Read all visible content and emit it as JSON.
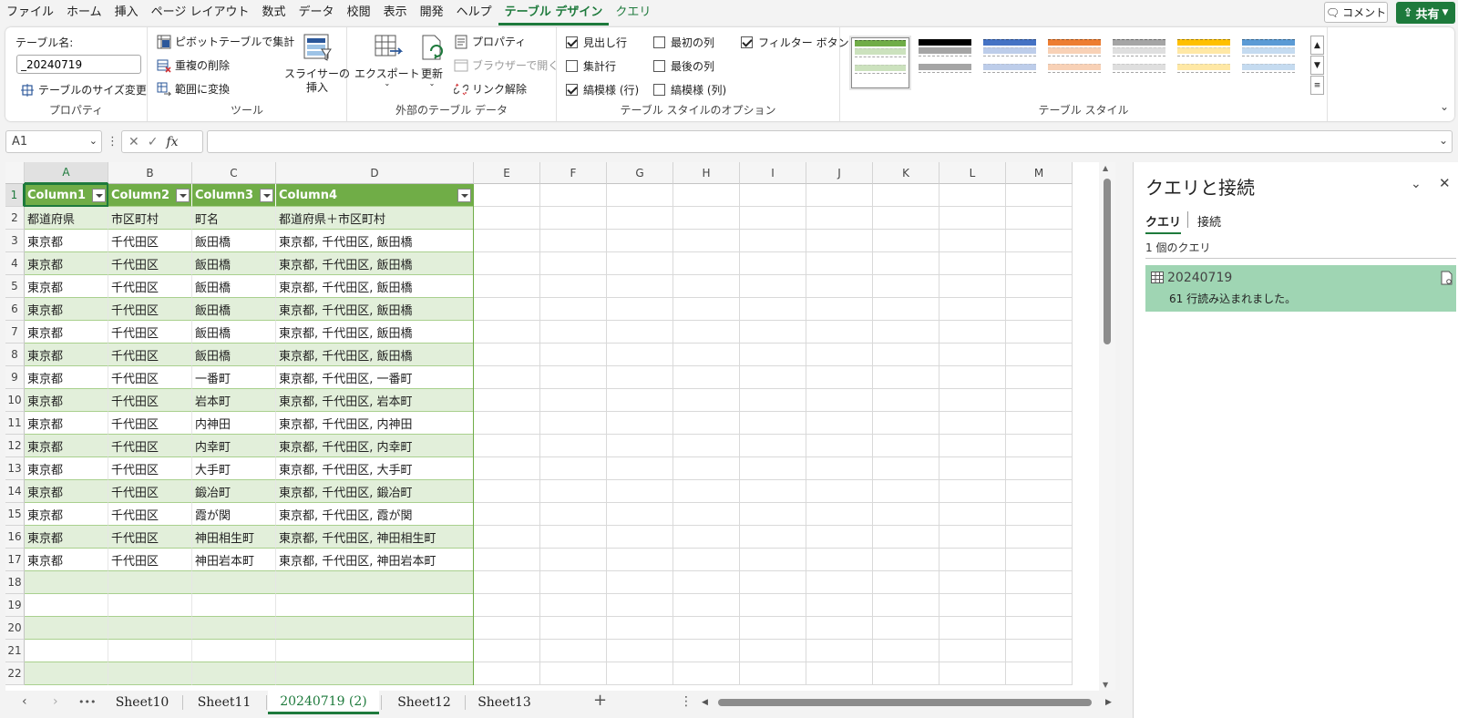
{
  "menu": {
    "tabs": [
      "ファイル",
      "ホーム",
      "挿入",
      "ページ レイアウト",
      "数式",
      "データ",
      "校閲",
      "表示",
      "開発",
      "ヘルプ",
      "テーブル デザイン",
      "クエリ"
    ],
    "active_index": 10,
    "comment_label": "コメント",
    "share_label": "共有"
  },
  "ribbon": {
    "properties": {
      "table_name_label": "テーブル名:",
      "table_name_value": "_20240719",
      "resize_label": "テーブルのサイズ変更",
      "group_label": "プロパティ"
    },
    "tools": {
      "pivot_label": "ピボットテーブルで集計",
      "remove_dup_label": "重複の削除",
      "convert_label": "範囲に変換",
      "slicer_label_1": "スライサーの",
      "slicer_label_2": "挿入",
      "group_label": "ツール"
    },
    "external": {
      "export_label": "エクスポート",
      "refresh_label": "更新",
      "properties_label": "プロパティ",
      "browser_label": "ブラウザーで開く",
      "unlink_label": "リンク解除",
      "group_label": "外部のテーブル データ"
    },
    "style_options": {
      "header_row": "見出し行",
      "total_row": "集計行",
      "banded_rows": "縞模様 (行)",
      "first_col": "最初の列",
      "last_col": "最後の列",
      "banded_cols": "縞模様 (列)",
      "filter_btn": "フィルター ボタン",
      "group_label": "テーブル スタイルのオプション",
      "header_row_checked": true,
      "total_row_checked": false,
      "banded_rows_checked": true,
      "first_col_checked": false,
      "last_col_checked": false,
      "banded_cols_checked": false,
      "filter_btn_checked": true
    },
    "styles": {
      "group_label": "テーブル スタイル",
      "swatch_colors": [
        "#70ad47",
        "#000000",
        "#4472c4",
        "#ed7d31",
        "#a5a5a5",
        "#ffc000",
        "#5b9bd5"
      ]
    }
  },
  "formula_bar": {
    "cell_ref": "A1",
    "fx_label": "fx",
    "formula": ""
  },
  "grid": {
    "columns": [
      "A",
      "B",
      "C",
      "D",
      "E",
      "F",
      "G",
      "H",
      "I",
      "J",
      "K",
      "L",
      "M"
    ],
    "rows": [
      "1",
      "2",
      "3",
      "4",
      "5",
      "6",
      "7",
      "8",
      "9",
      "10",
      "11",
      "12",
      "13",
      "14",
      "15",
      "16",
      "17",
      "18",
      "19",
      "20",
      "21",
      "22"
    ],
    "table_headers": [
      "Column1",
      "Column2",
      "Column3",
      "Column4"
    ],
    "table_rows": [
      [
        "都道府県",
        "市区町村",
        "町名",
        "都道府県＋市区町村"
      ],
      [
        "東京都",
        "千代田区",
        "飯田橋",
        "東京都, 千代田区, 飯田橋"
      ],
      [
        "東京都",
        "千代田区",
        "飯田橋",
        "東京都, 千代田区, 飯田橋"
      ],
      [
        "東京都",
        "千代田区",
        "飯田橋",
        "東京都, 千代田区, 飯田橋"
      ],
      [
        "東京都",
        "千代田区",
        "飯田橋",
        "東京都, 千代田区, 飯田橋"
      ],
      [
        "東京都",
        "千代田区",
        "飯田橋",
        "東京都, 千代田区, 飯田橋"
      ],
      [
        "東京都",
        "千代田区",
        "飯田橋",
        "東京都, 千代田区, 飯田橋"
      ],
      [
        "東京都",
        "千代田区",
        "一番町",
        "東京都, 千代田区, 一番町"
      ],
      [
        "東京都",
        "千代田区",
        "岩本町",
        "東京都, 千代田区, 岩本町"
      ],
      [
        "東京都",
        "千代田区",
        "内神田",
        "東京都, 千代田区, 内神田"
      ],
      [
        "東京都",
        "千代田区",
        "内幸町",
        "東京都, 千代田区, 内幸町"
      ],
      [
        "東京都",
        "千代田区",
        "大手町",
        "東京都, 千代田区, 大手町"
      ],
      [
        "東京都",
        "千代田区",
        "鍛冶町",
        "東京都, 千代田区, 鍛冶町"
      ],
      [
        "東京都",
        "千代田区",
        "霞が関",
        "東京都, 千代田区, 霞が関"
      ],
      [
        "東京都",
        "千代田区",
        "神田相生町",
        "東京都, 千代田区, 神田相生町"
      ],
      [
        "東京都",
        "千代田区",
        "神田岩本町",
        "東京都, 千代田区, 神田岩本町"
      ],
      [
        "",
        "",
        "",
        ""
      ],
      [
        "",
        "",
        "",
        ""
      ],
      [
        "",
        "",
        "",
        ""
      ],
      [
        "",
        "",
        "",
        ""
      ],
      [
        "",
        "",
        "",
        ""
      ]
    ]
  },
  "sheet_tabs": {
    "tabs": [
      "Sheet10",
      "Sheet11",
      "20240719 (2)",
      "Sheet12",
      "Sheet13"
    ],
    "active_index": 2,
    "more_label": "•••",
    "add_label": "+",
    "options_label": "⋮"
  },
  "query_panel": {
    "title": "クエリと接続",
    "tab_queries": "クエリ",
    "tab_connections": "接続",
    "count_text": "1 個のクエリ",
    "query_name": "20240719",
    "query_status": "61 行読み込まれました。"
  },
  "colors": {
    "accent": "#1e7a3c",
    "table_header": "#70ad47",
    "band": "#e2efda",
    "query_item": "#9fd5b3"
  }
}
